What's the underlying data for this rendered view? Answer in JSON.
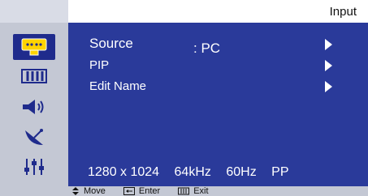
{
  "header": {
    "title": "Input"
  },
  "sidebar": {
    "icons": [
      "input-icon",
      "picture-icon",
      "sound-icon",
      "satellite-icon",
      "settings-icon"
    ]
  },
  "menu": {
    "items": [
      {
        "label": "Source",
        "value": ": PC"
      },
      {
        "label": "PIP"
      },
      {
        "label": "Edit Name"
      }
    ]
  },
  "status": {
    "resolution": "1280 x 1024",
    "hfreq": "64kHz",
    "vfreq": "60Hz",
    "mode": "PP"
  },
  "footer": {
    "move_label": "Move",
    "enter_label": "Enter",
    "exit_label": "Exit"
  },
  "colors": {
    "main_bg": "#2a3a9a",
    "sidebar_bg": "#c4c8d4",
    "active_icon_bg": "#1f2b8c"
  }
}
